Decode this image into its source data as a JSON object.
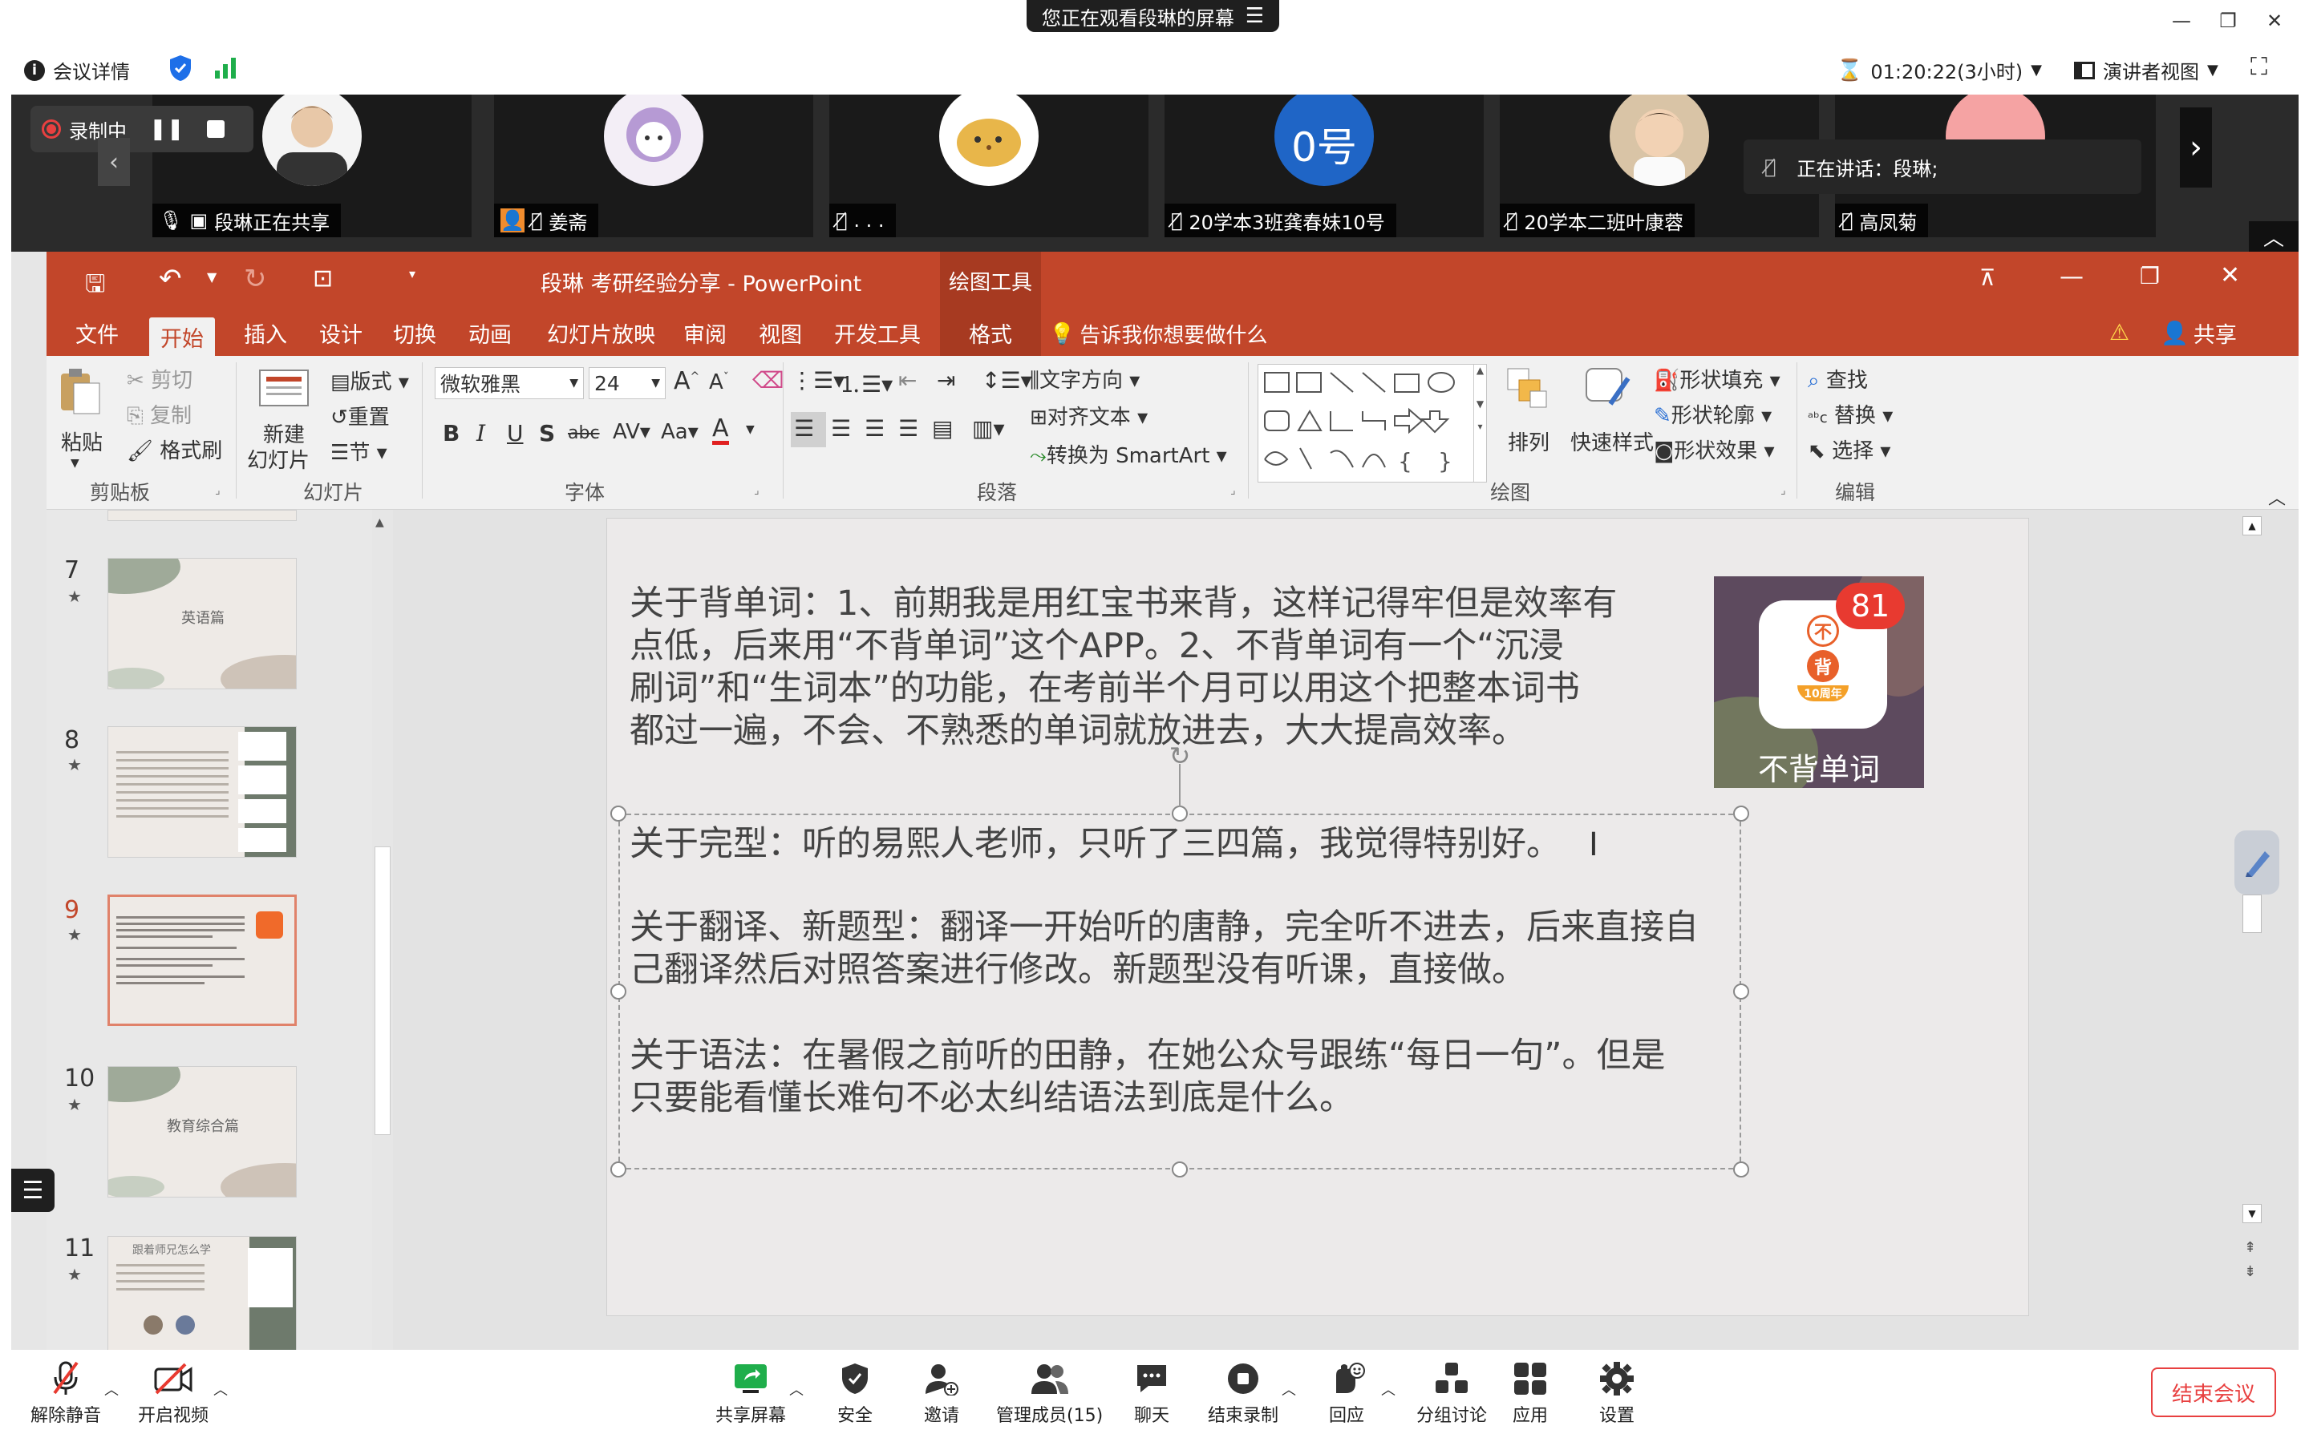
{
  "banner": {
    "text": "您正在观看段琳的屏幕"
  },
  "meeting": {
    "details_label": "会议详情",
    "timer": "01:20:22(3小时)",
    "view_label": "演讲者视图"
  },
  "recording": {
    "label": "录制中"
  },
  "participants": [
    {
      "name": "段琳正在共享"
    },
    {
      "name": "姜斋"
    },
    {
      "name": ". . ."
    },
    {
      "name": "20学本3班龚春妹10号",
      "avatar_text": "0号"
    },
    {
      "name": "20学本二班叶康蓉"
    },
    {
      "name": "高凤菊"
    }
  ],
  "speaking": {
    "label": "正在讲话：段琳;"
  },
  "ppt": {
    "title": "段琳 考研经验分享 - PowerPoint",
    "context_tab": "绘图工具",
    "share_label": "共享",
    "tabs": [
      "文件",
      "开始",
      "插入",
      "设计",
      "切换",
      "动画",
      "幻灯片放映",
      "审阅",
      "视图",
      "开发工具",
      "格式"
    ],
    "tell_me": "告诉我你想要做什么",
    "ribbon": {
      "paste": "粘贴",
      "cut": "剪切",
      "copy": "复制",
      "format_painter": "格式刷",
      "clipboard": "剪贴板",
      "new_slide_1": "新建",
      "new_slide_2": "幻灯片",
      "layout": "版式",
      "reset": "重置",
      "section": "节",
      "slides": "幻灯片",
      "font_name": "微软雅黑",
      "font_size": "24",
      "font": "字体",
      "paragraph": "段落",
      "text_direction": "文字方向",
      "align_text": "对齐文本",
      "smartart": "转换为 SmartArt",
      "arrange": "排列",
      "quick_styles": "快速样式",
      "shape_fill": "形状填充",
      "shape_outline": "形状轮廓",
      "shape_effects": "形状效果",
      "drawing": "绘图",
      "find": "查找",
      "replace": "替换",
      "select": "选择",
      "editing": "编辑"
    },
    "thumbnails": [
      {
        "num": "7",
        "caption": "英语篇"
      },
      {
        "num": "8",
        "caption": ""
      },
      {
        "num": "9",
        "caption": ""
      },
      {
        "num": "10",
        "caption": "教育综合篇"
      },
      {
        "num": "11",
        "caption": "跟着师兄怎么学"
      }
    ],
    "slide": {
      "para1": [
        "关于背单词：1、前期我是用红宝书来背，这样记得牢但是效率有",
        "点低，后来用“不背单词”这个APP。2、不背单词有一个“沉浸",
        "刷词”和“生词本”的功能，在考前半个月可以用这个把整本词书",
        "都过一遍，不会、不熟悉的单词就放进去，大大提高效率。"
      ],
      "para2": [
        "关于完型：听的易熙人老师，只听了三四篇，我觉得特别好。"
      ],
      "para3": [
        "关于翻译、新题型：翻译一开始听的唐静，完全听不进去，后来直接自",
        "己翻译然后对照答案进行修改。新题型没有听课，直接做。"
      ],
      "para4": [
        "关于语法：在暑假之前听的田静，在她公众号跟练“每日一句”。但是",
        "只要能看懂长难句不必太纠结语法到底是什么。"
      ],
      "app_badge": "81",
      "app_name": "不背单词",
      "app_icon_top": "不",
      "app_icon_mid": "背",
      "app_icon_bottom": "10周年"
    }
  },
  "toolbar": {
    "mute": "解除静音",
    "video": "开启视频",
    "share": "共享屏幕",
    "security": "安全",
    "invite": "邀请",
    "members": "管理成员(15)",
    "chat": "聊天",
    "end_recording": "结束录制",
    "reactions": "回应",
    "breakout": "分组讨论",
    "apps": "应用",
    "settings": "设置",
    "end_meeting": "结束会议"
  }
}
